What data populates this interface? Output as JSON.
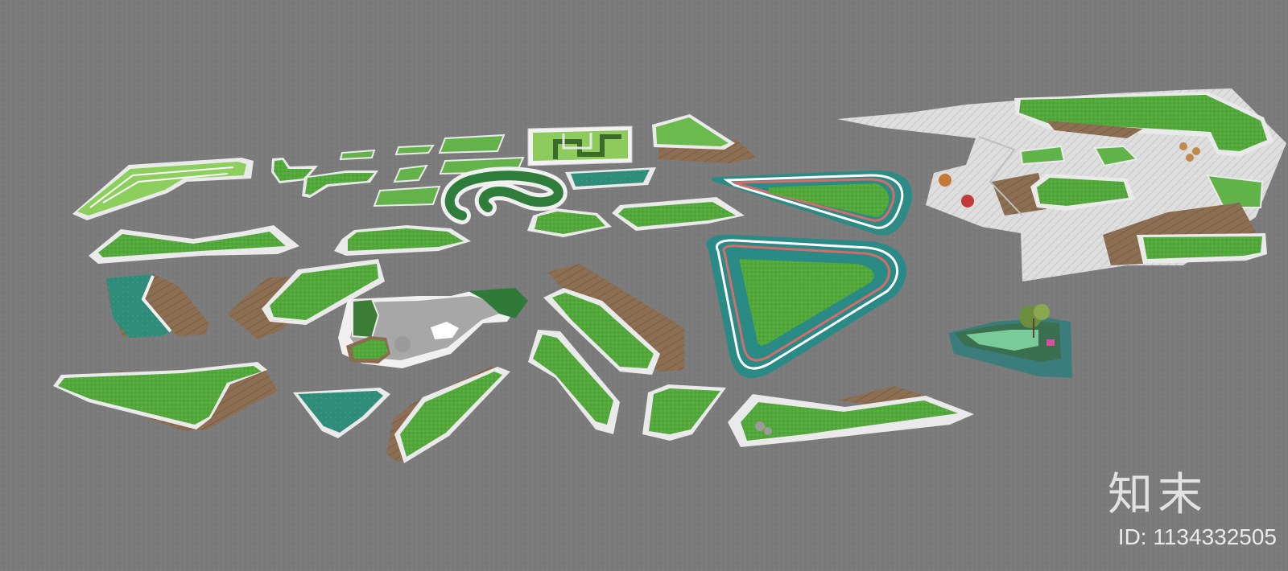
{
  "colors": {
    "ground": "#7d7d7d",
    "grass": "#4fa63a",
    "grass_light": "#7cc054",
    "curb": "#eaeaea",
    "wood": "#8a6c50",
    "teal": "#2f8a78",
    "track_red": "#c4575a",
    "plaza": "#dcdcdc"
  },
  "watermark": {
    "brand": "知末",
    "id_text": "ID: 1134332505"
  }
}
